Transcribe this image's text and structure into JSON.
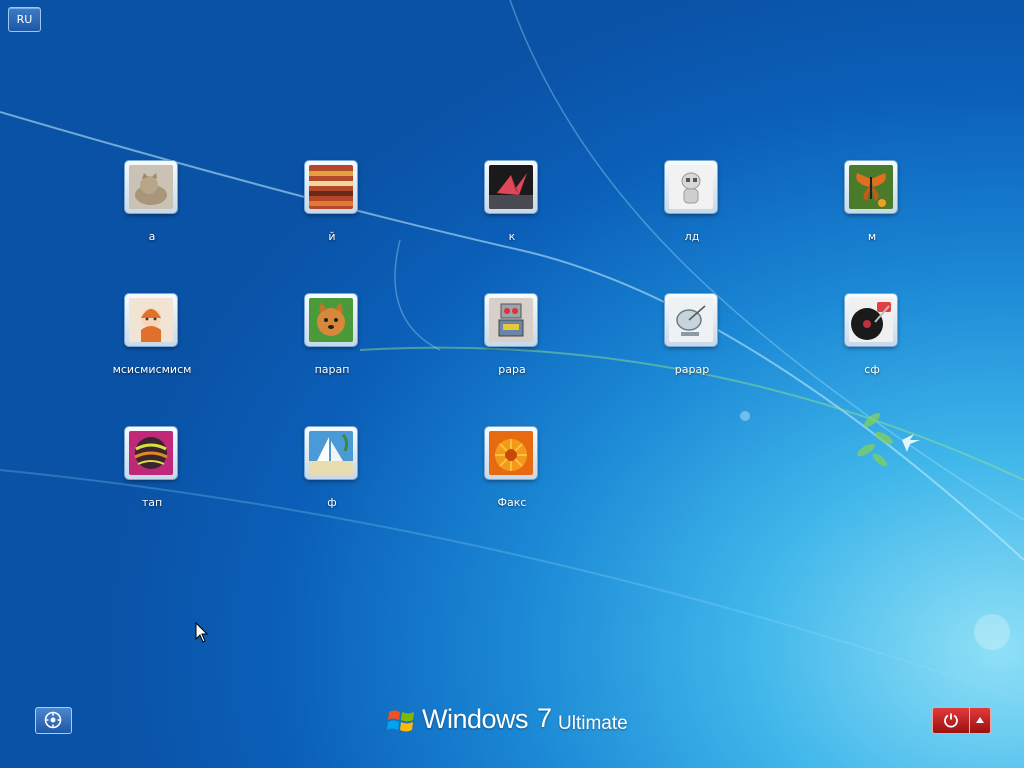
{
  "language": "RU",
  "users": [
    {
      "name": "а",
      "icon": "kitten-avatar-icon"
    },
    {
      "name": "й",
      "icon": "striped-fabric-avatar-icon"
    },
    {
      "name": "к",
      "icon": "paper-crane-avatar-icon"
    },
    {
      "name": "лд",
      "icon": "robot-figure-avatar-icon"
    },
    {
      "name": "м",
      "icon": "butterfly-avatar-icon"
    },
    {
      "name": "мсисмисмисм",
      "icon": "doll-avatar-icon"
    },
    {
      "name": "парап",
      "icon": "puppy-avatar-icon"
    },
    {
      "name": "рара",
      "icon": "toy-robot-avatar-icon"
    },
    {
      "name": "рарар",
      "icon": "satellite-dish-avatar-icon"
    },
    {
      "name": "сф",
      "icon": "turntable-avatar-icon"
    },
    {
      "name": "тап",
      "icon": "ball-avatar-icon"
    },
    {
      "name": "ф",
      "icon": "sailboat-avatar-icon"
    },
    {
      "name": "Факс",
      "icon": "orange-flower-avatar-icon"
    }
  ],
  "brand": {
    "name": "Windows",
    "version": "7",
    "edition": "Ultimate"
  },
  "controls": {
    "accessibility": "ease-of-access-icon",
    "power": "power-icon",
    "power_menu": "arrow-up-icon"
  },
  "colors": {
    "power_button": "#c0392b",
    "background_top": "#0a52a6",
    "background_glow": "#8fe0f6"
  }
}
